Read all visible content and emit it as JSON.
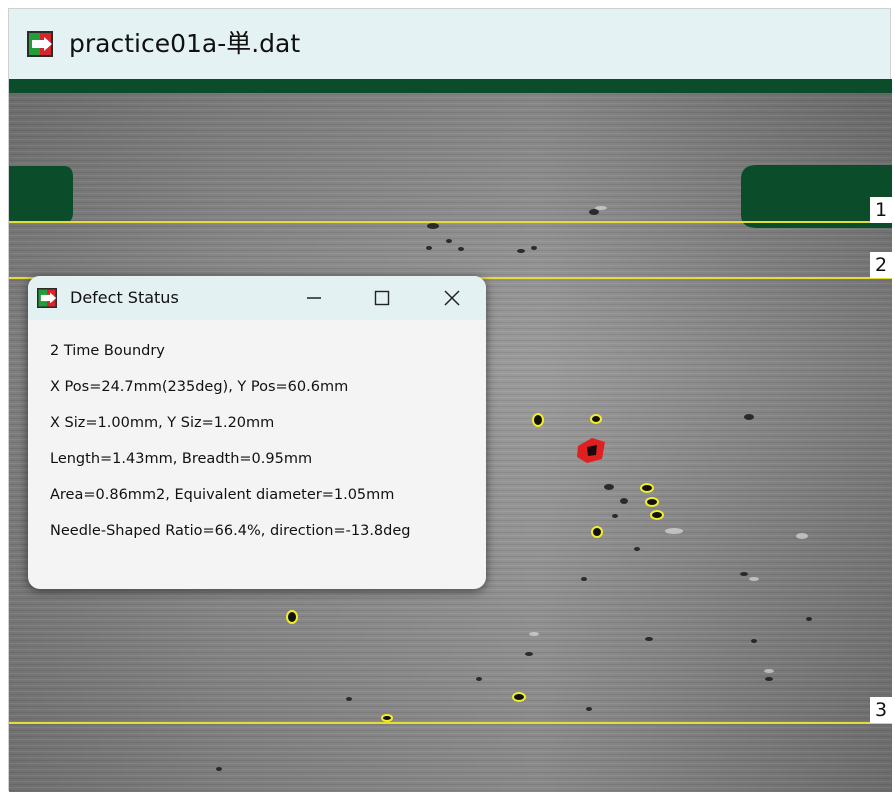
{
  "window": {
    "title": "practice01a-単.dat",
    "icon": "app-icon"
  },
  "image": {
    "boundaries": [
      {
        "label": "1"
      },
      {
        "label": "2"
      },
      {
        "label": "3"
      }
    ]
  },
  "dialog": {
    "title": "Defect Status",
    "icon": "app-icon",
    "controls": {
      "minimize": "minimize-icon",
      "maximize": "maximize-icon",
      "close": "close-icon"
    },
    "lines": [
      "2 Time Boundry",
      "X Pos=24.7mm(235deg), Y Pos=60.6mm",
      "X Siz=1.00mm, Y Siz=1.20mm",
      "Length=1.43mm, Breadth=0.95mm",
      "Area=0.86mm2, Equivalent diameter=1.05mm",
      "Needle-Shaped Ratio=66.4%, direction=-13.8deg"
    ]
  },
  "colors": {
    "boundary_line": "#e5dc3a",
    "defect_outline": "#f3ee2a",
    "selected_defect": "#e02020",
    "masked_region": "#0b4d2a"
  }
}
